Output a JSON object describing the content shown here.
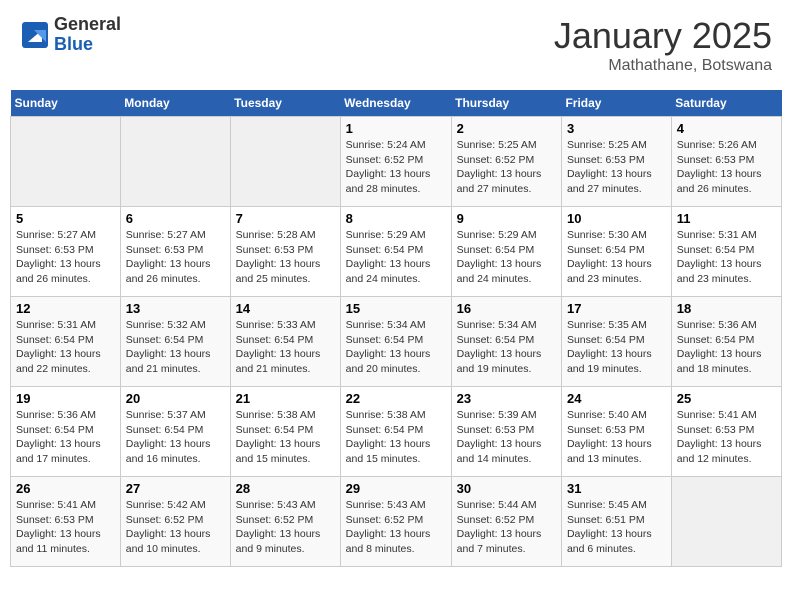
{
  "header": {
    "logo_general": "General",
    "logo_blue": "Blue",
    "title": "January 2025",
    "subtitle": "Mathathane, Botswana"
  },
  "weekdays": [
    "Sunday",
    "Monday",
    "Tuesday",
    "Wednesday",
    "Thursday",
    "Friday",
    "Saturday"
  ],
  "weeks": [
    [
      {
        "day": "",
        "empty": true
      },
      {
        "day": "",
        "empty": true
      },
      {
        "day": "",
        "empty": true
      },
      {
        "day": "1",
        "sunrise": "5:24 AM",
        "sunset": "6:52 PM",
        "daylight": "13 hours and 28 minutes."
      },
      {
        "day": "2",
        "sunrise": "5:25 AM",
        "sunset": "6:52 PM",
        "daylight": "13 hours and 27 minutes."
      },
      {
        "day": "3",
        "sunrise": "5:25 AM",
        "sunset": "6:53 PM",
        "daylight": "13 hours and 27 minutes."
      },
      {
        "day": "4",
        "sunrise": "5:26 AM",
        "sunset": "6:53 PM",
        "daylight": "13 hours and 26 minutes."
      }
    ],
    [
      {
        "day": "5",
        "sunrise": "5:27 AM",
        "sunset": "6:53 PM",
        "daylight": "13 hours and 26 minutes."
      },
      {
        "day": "6",
        "sunrise": "5:27 AM",
        "sunset": "6:53 PM",
        "daylight": "13 hours and 26 minutes."
      },
      {
        "day": "7",
        "sunrise": "5:28 AM",
        "sunset": "6:53 PM",
        "daylight": "13 hours and 25 minutes."
      },
      {
        "day": "8",
        "sunrise": "5:29 AM",
        "sunset": "6:54 PM",
        "daylight": "13 hours and 24 minutes."
      },
      {
        "day": "9",
        "sunrise": "5:29 AM",
        "sunset": "6:54 PM",
        "daylight": "13 hours and 24 minutes."
      },
      {
        "day": "10",
        "sunrise": "5:30 AM",
        "sunset": "6:54 PM",
        "daylight": "13 hours and 23 minutes."
      },
      {
        "day": "11",
        "sunrise": "5:31 AM",
        "sunset": "6:54 PM",
        "daylight": "13 hours and 23 minutes."
      }
    ],
    [
      {
        "day": "12",
        "sunrise": "5:31 AM",
        "sunset": "6:54 PM",
        "daylight": "13 hours and 22 minutes."
      },
      {
        "day": "13",
        "sunrise": "5:32 AM",
        "sunset": "6:54 PM",
        "daylight": "13 hours and 21 minutes."
      },
      {
        "day": "14",
        "sunrise": "5:33 AM",
        "sunset": "6:54 PM",
        "daylight": "13 hours and 21 minutes."
      },
      {
        "day": "15",
        "sunrise": "5:34 AM",
        "sunset": "6:54 PM",
        "daylight": "13 hours and 20 minutes."
      },
      {
        "day": "16",
        "sunrise": "5:34 AM",
        "sunset": "6:54 PM",
        "daylight": "13 hours and 19 minutes."
      },
      {
        "day": "17",
        "sunrise": "5:35 AM",
        "sunset": "6:54 PM",
        "daylight": "13 hours and 19 minutes."
      },
      {
        "day": "18",
        "sunrise": "5:36 AM",
        "sunset": "6:54 PM",
        "daylight": "13 hours and 18 minutes."
      }
    ],
    [
      {
        "day": "19",
        "sunrise": "5:36 AM",
        "sunset": "6:54 PM",
        "daylight": "13 hours and 17 minutes."
      },
      {
        "day": "20",
        "sunrise": "5:37 AM",
        "sunset": "6:54 PM",
        "daylight": "13 hours and 16 minutes."
      },
      {
        "day": "21",
        "sunrise": "5:38 AM",
        "sunset": "6:54 PM",
        "daylight": "13 hours and 15 minutes."
      },
      {
        "day": "22",
        "sunrise": "5:38 AM",
        "sunset": "6:54 PM",
        "daylight": "13 hours and 15 minutes."
      },
      {
        "day": "23",
        "sunrise": "5:39 AM",
        "sunset": "6:53 PM",
        "daylight": "13 hours and 14 minutes."
      },
      {
        "day": "24",
        "sunrise": "5:40 AM",
        "sunset": "6:53 PM",
        "daylight": "13 hours and 13 minutes."
      },
      {
        "day": "25",
        "sunrise": "5:41 AM",
        "sunset": "6:53 PM",
        "daylight": "13 hours and 12 minutes."
      }
    ],
    [
      {
        "day": "26",
        "sunrise": "5:41 AM",
        "sunset": "6:53 PM",
        "daylight": "13 hours and 11 minutes."
      },
      {
        "day": "27",
        "sunrise": "5:42 AM",
        "sunset": "6:52 PM",
        "daylight": "13 hours and 10 minutes."
      },
      {
        "day": "28",
        "sunrise": "5:43 AM",
        "sunset": "6:52 PM",
        "daylight": "13 hours and 9 minutes."
      },
      {
        "day": "29",
        "sunrise": "5:43 AM",
        "sunset": "6:52 PM",
        "daylight": "13 hours and 8 minutes."
      },
      {
        "day": "30",
        "sunrise": "5:44 AM",
        "sunset": "6:52 PM",
        "daylight": "13 hours and 7 minutes."
      },
      {
        "day": "31",
        "sunrise": "5:45 AM",
        "sunset": "6:51 PM",
        "daylight": "13 hours and 6 minutes."
      },
      {
        "day": "",
        "empty": true
      }
    ]
  ]
}
